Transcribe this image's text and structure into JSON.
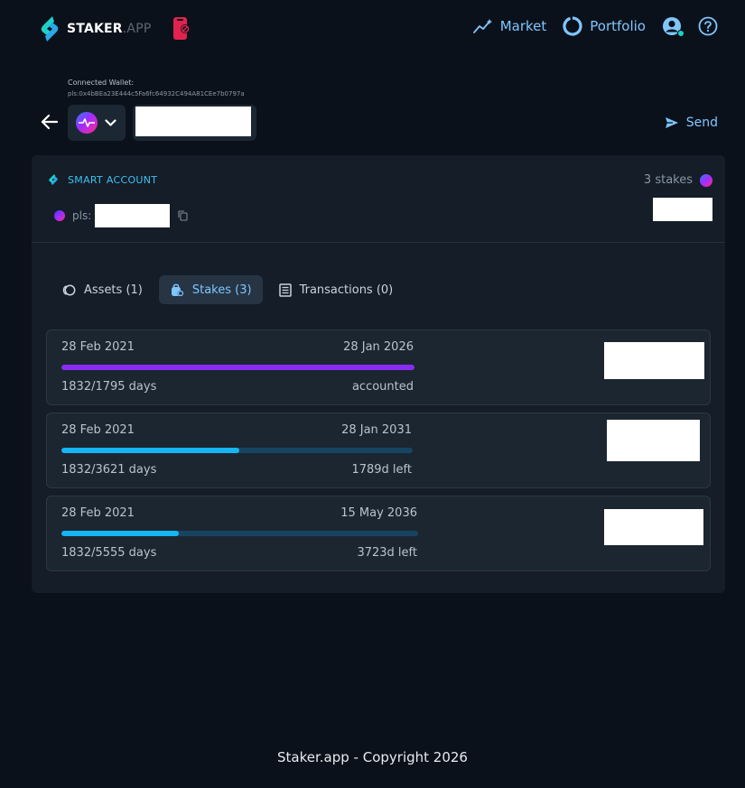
{
  "header": {
    "brand": "STAKER",
    "brand_suffix": ".APP",
    "nav": {
      "market": "Market",
      "portfolio": "Portfolio"
    }
  },
  "wallet": {
    "connected_label": "Connected Wallet:",
    "address": "pls:0x4bBEa23E444c5Fa6fc64932C494A81CEe7b0797a",
    "send_label": "Send"
  },
  "account": {
    "title": "SMART ACCOUNT",
    "stakes_count": "3 stakes",
    "prefix": "pls:"
  },
  "tabs": [
    {
      "label": "Assets (1)"
    },
    {
      "label": "Stakes (3)"
    },
    {
      "label": "Transactions (0)"
    }
  ],
  "stakes": [
    {
      "start": "28 Feb 2021",
      "end": "28 Jan 2026",
      "days": "1832/1795 days",
      "status": "accounted",
      "progress": 1.0,
      "color": "#8a2cf0"
    },
    {
      "start": "28 Feb 2021",
      "end": "28 Jan 2031",
      "days": "1832/3621 days",
      "status": "1789d left",
      "progress": 0.506,
      "color": "#16b5f5"
    },
    {
      "start": "28 Feb 2021",
      "end": "15 May 2036",
      "days": "1832/5555 days",
      "status": "3723d left",
      "progress": 0.33,
      "color": "#16b5f5"
    }
  ],
  "footer": {
    "text": "Staker.app - Copyright 2026"
  }
}
